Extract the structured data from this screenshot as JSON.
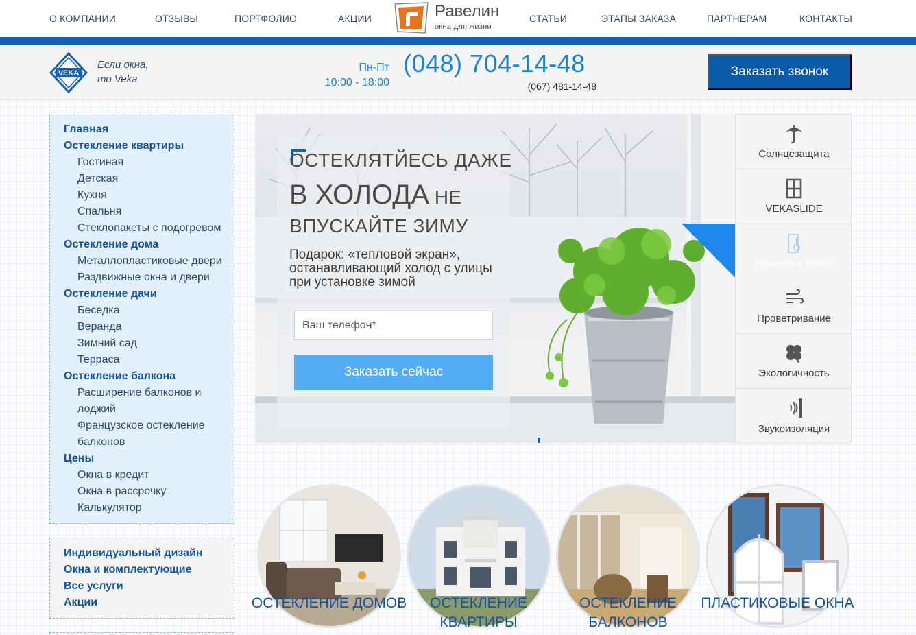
{
  "nav": {
    "left": [
      "О компании",
      "Отзывы",
      "Портфолио",
      "Акции"
    ],
    "right": [
      "Статьи",
      "Этапы заказа",
      "Партнерам",
      "Контакты"
    ]
  },
  "logo": {
    "name": "Равелин",
    "tagline": "окна для жизни"
  },
  "contact": {
    "slogan_line1": "Если окна,",
    "slogan_line2": "то Veka",
    "hours_days": "Пн-Пт",
    "hours_time": "10:00 - 18:00",
    "phone_main": "(048) 704-14-48",
    "phone_alt": "(067) 481-14-48",
    "callback_button": "Заказать звонок",
    "brand_badge": "VEKA"
  },
  "sidebar": {
    "main": [
      {
        "label": "Главная",
        "level": 1
      },
      {
        "label": "Остекление квартиры",
        "level": 1
      },
      {
        "label": "Гостиная",
        "level": 2
      },
      {
        "label": "Детская",
        "level": 2
      },
      {
        "label": "Кухня",
        "level": 2
      },
      {
        "label": "Спальня",
        "level": 2
      },
      {
        "label": "Стеклопакеты с подогревом",
        "level": 2
      },
      {
        "label": "Остекление дома",
        "level": 1
      },
      {
        "label": "Металлопластиковые двери",
        "level": 2
      },
      {
        "label": "Раздвижные окна и двери",
        "level": 2
      },
      {
        "label": "Остекление дачи",
        "level": 1
      },
      {
        "label": "Беседка",
        "level": 2
      },
      {
        "label": "Веранда",
        "level": 2
      },
      {
        "label": "Зимний сад",
        "level": 2
      },
      {
        "label": "Терраса",
        "level": 2
      },
      {
        "label": "Остекление балкона",
        "level": 1
      },
      {
        "label": "Расширение балконов и",
        "level": 2
      },
      {
        "label": "лоджий",
        "level": 2
      },
      {
        "label": "Французское остекление",
        "level": 2
      },
      {
        "label": "балконов",
        "level": 2
      },
      {
        "label": "Цены",
        "level": 1
      },
      {
        "label": "Окна в кредит",
        "level": 2
      },
      {
        "label": "Окна в рассрочку",
        "level": 2
      },
      {
        "label": "Калькулятор",
        "level": 2
      }
    ],
    "secondary": [
      "Индивидуальный дизайн",
      "Окна и комплектующие",
      "Все услуги",
      "Акции"
    ]
  },
  "hero": {
    "line1": "Остеклятйесь даже",
    "line2_big": "в холода",
    "line2_small": " не",
    "line3": "впускайте зиму",
    "description": "Подарок: «тепловой экран», останавливающий холод с улицы при установке зимой",
    "phone_placeholder": "Ваш телефон*",
    "order_button": "Заказать сейчас"
  },
  "tabs": [
    {
      "label": "Солнцезащита",
      "icon": "umbrella-icon",
      "active": false
    },
    {
      "label": "VEKASLIDE",
      "icon": "window-frame-icon",
      "active": false
    },
    {
      "label": "Установка зимой",
      "icon": "thermometer-icon",
      "active": true
    },
    {
      "label": "Проветривание",
      "icon": "wind-icon",
      "active": false
    },
    {
      "label": "Экологичность",
      "icon": "clover-icon",
      "active": false
    },
    {
      "label": "Звукоизоляция",
      "icon": "sound-wave-icon",
      "active": false
    }
  ],
  "categories": [
    {
      "label_line1": "Остекление домов",
      "label_line2": ""
    },
    {
      "label_line1": "Остекление",
      "label_line2": "квартиры"
    },
    {
      "label_line1": "Остекление",
      "label_line2": "балконов"
    },
    {
      "label_line1": "Пластиковые окна",
      "label_line2": ""
    }
  ],
  "colors": {
    "brand_blue": "#1561b4",
    "accent_blue": "#1e88ea",
    "phone_blue": "#1a84d4",
    "button_light_blue": "#52adf5",
    "logo_orange": "#e8741f"
  }
}
